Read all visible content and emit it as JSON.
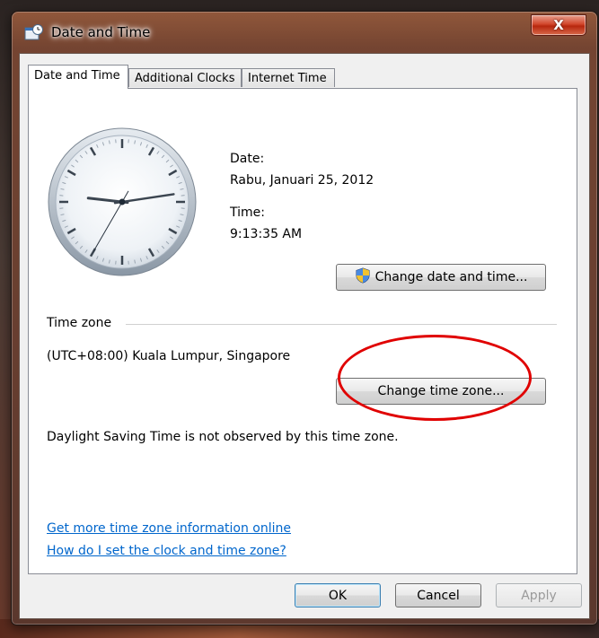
{
  "window": {
    "title": "Date and Time",
    "close_label": "X"
  },
  "tabs": [
    {
      "label": "Date and Time",
      "active": true
    },
    {
      "label": "Additional Clocks",
      "active": false
    },
    {
      "label": "Internet Time",
      "active": false
    }
  ],
  "datetime": {
    "date_label": "Date:",
    "date_value": "Rabu, Januari 25, 2012",
    "time_label": "Time:",
    "time_value": "9:13:35 AM",
    "change_button": "Change date and time..."
  },
  "clock": {
    "hours": 9,
    "minutes": 13,
    "seconds": 35
  },
  "timezone": {
    "group_label": "Time zone",
    "value": "(UTC+08:00) Kuala Lumpur, Singapore",
    "change_button": "Change time zone...",
    "dst_note": "Daylight Saving Time is not observed by this time zone."
  },
  "links": {
    "more_info": "Get more time zone information online",
    "how_to": "How do I set the clock and time zone?"
  },
  "footer": {
    "ok": "OK",
    "cancel": "Cancel",
    "apply": "Apply"
  },
  "colors": {
    "link": "#0066cc",
    "annotation": "#e00000",
    "close": "#c7361c"
  }
}
